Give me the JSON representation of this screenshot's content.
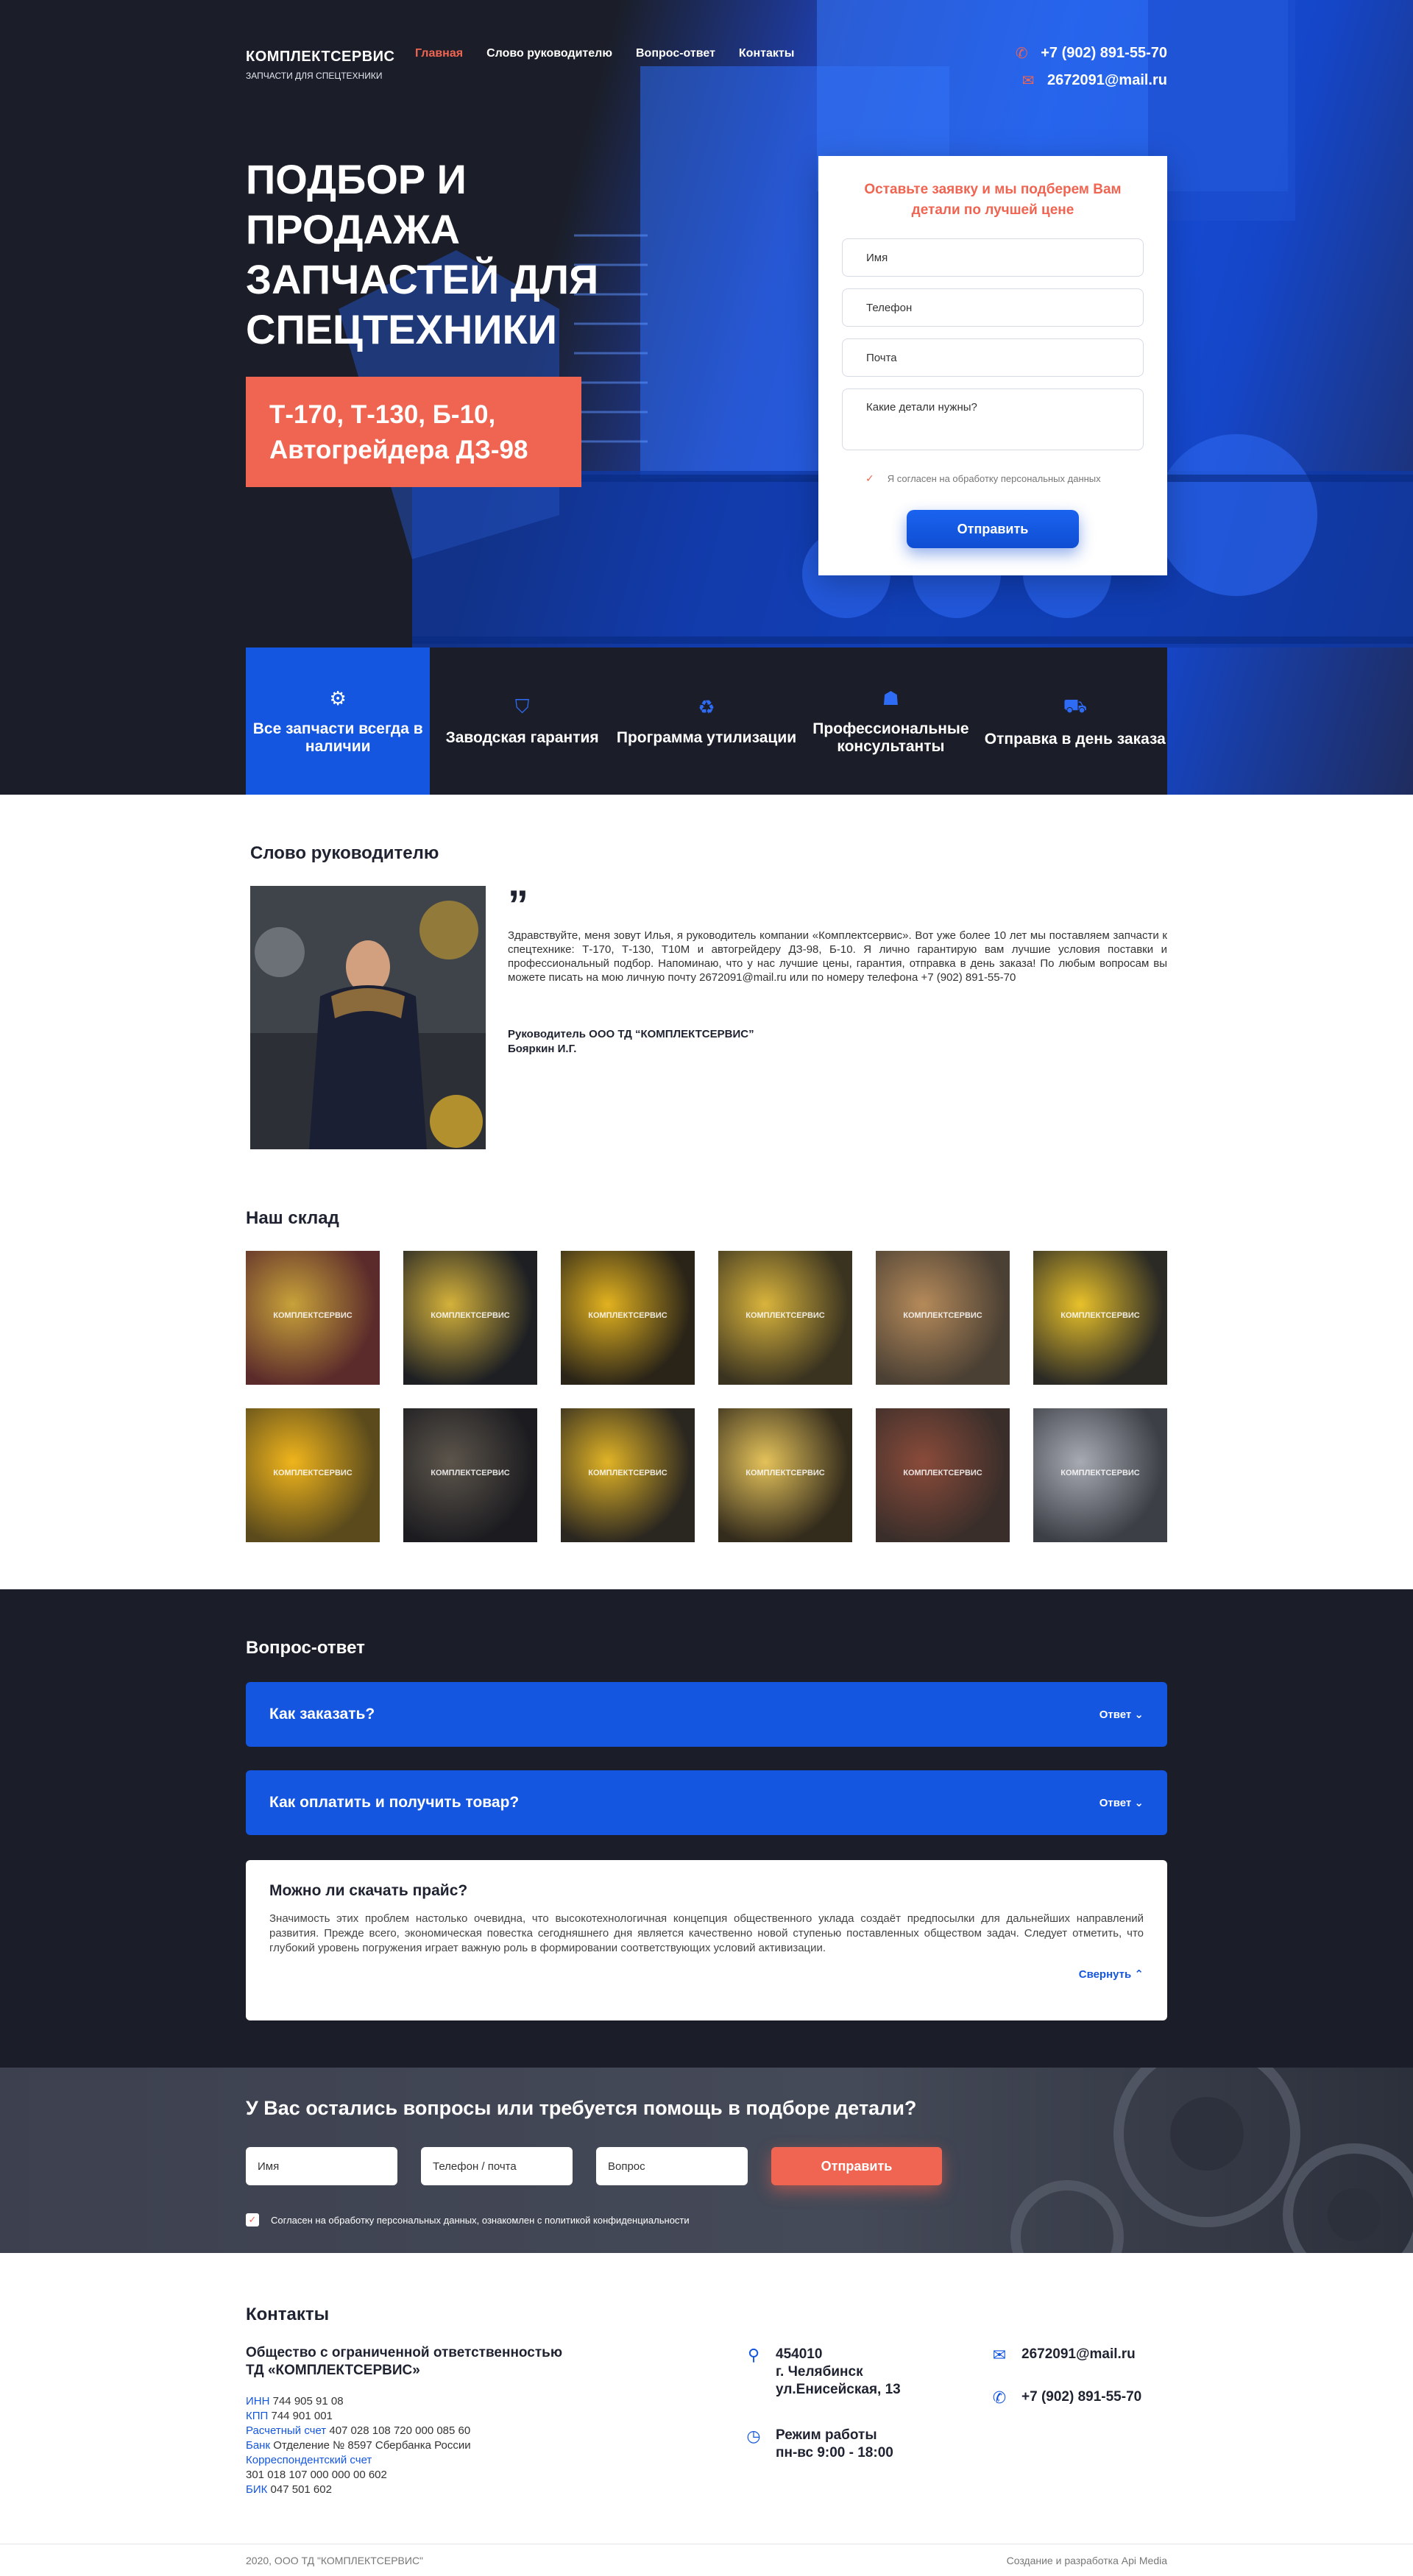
{
  "header": {
    "logo_title": "КОМПЛЕКТСЕРВИС",
    "logo_subtitle": "ЗАПЧАСТИ ДЛЯ СПЕЦТЕХНИКИ",
    "menu": [
      {
        "label": "Главная",
        "active": true
      },
      {
        "label": "Слово руководителю",
        "active": false
      },
      {
        "label": "Вопрос-ответ",
        "active": false
      },
      {
        "label": "Контакты",
        "active": false
      }
    ],
    "phone": "+7 (902) 891-55-70",
    "email": "2672091@mail.ru"
  },
  "hero": {
    "title": "ПОДБОР И ПРОДАЖА ЗАПЧАСТЕЙ ДЛЯ СПЕЦТЕХНИКИ",
    "badge": "Т-170, Т-130, Б-10, Автогрейдера ДЗ-98",
    "accent_color": "#f06452",
    "brand_blue": "#1456e0"
  },
  "lead_form": {
    "title": "Оставьте заявку и мы подберем Вам детали по лучшей цене",
    "name_placeholder": "Имя",
    "phone_placeholder": "Телефон",
    "email_placeholder": "Почта",
    "details_placeholder": "Какие детали нужны?",
    "agree": "Я согласен на обработку персональных данных",
    "submit": "Отправить"
  },
  "features": [
    {
      "icon": "gear-icon",
      "label": "Все запчасти всегда в наличии"
    },
    {
      "icon": "shield-icon",
      "label": "Заводская гарантия"
    },
    {
      "icon": "recycle-icon",
      "label": "Программа утилизации"
    },
    {
      "icon": "consultant-icon",
      "label": "Профессиональные консультанты"
    },
    {
      "icon": "truck-icon",
      "label": "Отправка в день заказа"
    }
  ],
  "director": {
    "title": "Слово руководителю",
    "quote_mark": "”",
    "text": "Здравствуйте, меня зовут Илья, я руководитель компании «Комплектсервис». Вот уже более 10 лет мы поставляем запчасти к спецтехнике: Т-170, Т-130, Т10М и автогрейдеру ДЗ-98, Б-10. Я лично гарантирую вам лучшие условия поставки и профессиональный подбор. Напоминаю, что у нас лучшие цены, гарантия, отправка в день заказа! По любым вопросам вы можете писать на мою личную почту 2672091@mail.ru или по номеру телефона +7 (902) 891-55-70",
    "sign_position": "Руководитель ООО ТД “КОМПЛЕКТСЕРВИС”",
    "sign_name": "Бояркин И.Г."
  },
  "warehouse": {
    "title": "Наш склад",
    "watermark": "КОМПЛЕКТСЕРВИС",
    "photos": [
      {
        "c1": "#5b2b2b",
        "c2": "#c8a23a"
      },
      {
        "c1": "#1d1f23",
        "c2": "#d5b23b"
      },
      {
        "c1": "#2a2418",
        "c2": "#e2b21f"
      },
      {
        "c1": "#3a3320",
        "c2": "#d9b43c"
      },
      {
        "c1": "#4b4034",
        "c2": "#b58a5a"
      },
      {
        "c1": "#2b2a25",
        "c2": "#e8c12a"
      },
      {
        "c1": "#5a4a1c",
        "c2": "#f0b51c"
      },
      {
        "c1": "#1c1c20",
        "c2": "#5c554b"
      },
      {
        "c1": "#2a2620",
        "c2": "#e0b326"
      },
      {
        "c1": "#332b1c",
        "c2": "#e4c25a"
      },
      {
        "c1": "#3a2e2a",
        "c2": "#8a4b3a"
      },
      {
        "c1": "#3c3f46",
        "c2": "#a7aab2"
      }
    ]
  },
  "faq": {
    "title": "Вопрос-ответ",
    "answer_label": "Ответ",
    "collapse_label": "Свернуть",
    "items": [
      {
        "q": "Как заказать?"
      },
      {
        "q": "Как оплатить и получить товар?"
      }
    ],
    "open_item": {
      "q": "Можно ли скачать прайс?",
      "a": "Значимость этих проблем настолько очевидна, что высокотехнологичная концепция общественного уклада создаёт предпосылки для дальнейших направлений развития. Прежде всего, экономическая повестка сегодняшнего дня является качественно новой ступенью поставленных обществом задач. Следует отметить, что глубокий уровень погружения играет важную роль в формировании соответствующих условий активизации."
    }
  },
  "help": {
    "title": "У Вас остались вопросы или требуется помощь в подборе детали?",
    "name_placeholder": "Имя",
    "contact_placeholder": "Телефон / почта",
    "question_placeholder": "Вопрос",
    "submit": "Отправить",
    "agree": "Согласен на обработку персональных данных, ознакомлен с политикой конфиденциальности"
  },
  "contacts": {
    "title": "Контакты",
    "org_line1": "Общество с ограниченной ответственностью",
    "org_line2": "ТД «КОМПЛЕКТСЕРВИС»",
    "requisites": [
      {
        "k": "ИНН",
        "v": " 744 905 91 08"
      },
      {
        "k": "КПП",
        "v": " 744 901 001"
      },
      {
        "k": "Расчетный счет",
        "v": " 407 028 108 720 000 085 60"
      },
      {
        "k": "Банк",
        "v": " Отделение № 8597 Сбербанка России"
      },
      {
        "k": "Корреспондентский счет",
        "v": ""
      },
      {
        "k": "",
        "v": "301 018 107 000 000 00 602"
      },
      {
        "k": "БИК",
        "v": " 047 501 602"
      }
    ],
    "address_line1": "454010",
    "address_line2": "г. Челябинск",
    "address_line3": "ул.Енисейская, 13",
    "hours_title": "Режим работы",
    "hours": "пн-вс 9:00 - 18:00",
    "email": "2672091@mail.ru",
    "phone": "+7 (902) 891-55-70"
  },
  "footer": {
    "copyright": "2020, ООО ТД \"КОМПЛЕКТСЕРВИС\"",
    "credits": "Создание и разработка Api Media"
  }
}
